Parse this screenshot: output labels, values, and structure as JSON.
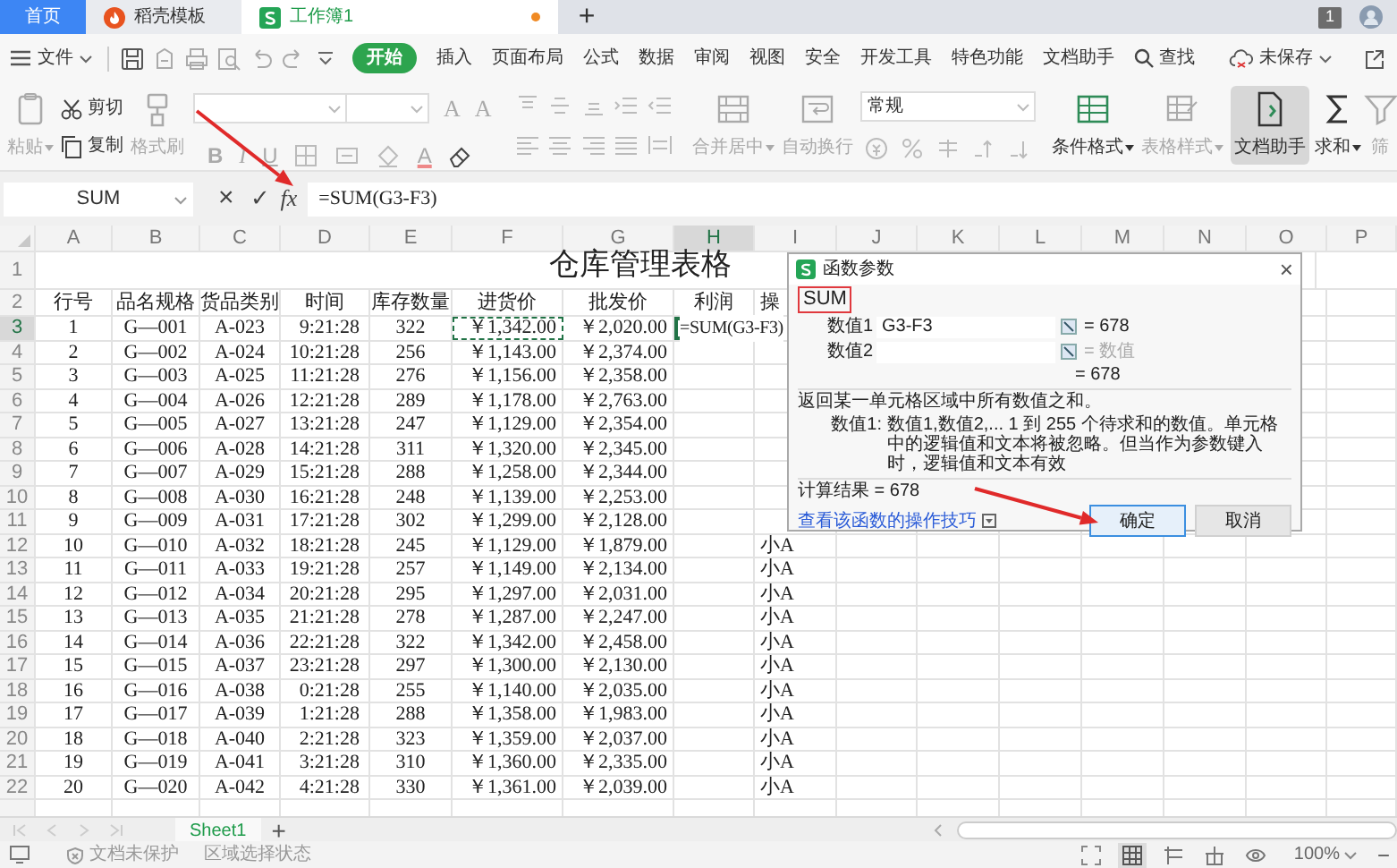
{
  "tabs": [
    {
      "kind": "home",
      "label": "首页",
      "selected": false
    },
    {
      "kind": "docer",
      "label": "稻壳模板",
      "selected": false
    },
    {
      "kind": "document",
      "label": "工作簿1",
      "selected": true,
      "unsaved": true
    }
  ],
  "new_tab": "+",
  "notification_count": "1",
  "menu": {
    "file": "文件",
    "items": [
      {
        "label": "开始",
        "selected": true
      },
      {
        "label": "插入",
        "selected": false
      },
      {
        "label": "页面布局",
        "selected": false
      },
      {
        "label": "公式",
        "selected": false
      },
      {
        "label": "数据",
        "selected": false
      },
      {
        "label": "审阅",
        "selected": false
      },
      {
        "label": "视图",
        "selected": false
      },
      {
        "label": "安全",
        "selected": false
      },
      {
        "label": "开发工具",
        "selected": false
      },
      {
        "label": "特色功能",
        "selected": false
      },
      {
        "label": "文档助手",
        "selected": false
      }
    ],
    "search": "查找",
    "save_status": "未保存"
  },
  "ribbon": [
    {
      "kind": "large",
      "label": "粘贴",
      "dropdown": true,
      "disabled": true,
      "pressed": false
    },
    {
      "kind": "stack",
      "items": [
        {
          "label": "剪切",
          "disabled": false
        },
        {
          "label": "复制",
          "disabled": false
        }
      ]
    },
    {
      "kind": "large",
      "label": "格式刷",
      "dropdown": false,
      "disabled": true,
      "pressed": false
    },
    {
      "kind": "font",
      "disabled": true,
      "size_buttons": [
        "A",
        "A"
      ],
      "style_buttons": [
        "B",
        "I",
        "U"
      ],
      "color_button": "A"
    },
    {
      "kind": "align",
      "disabled": true
    },
    {
      "kind": "large",
      "label": "合并居中",
      "dropdown": true,
      "disabled": true,
      "pressed": false
    },
    {
      "kind": "large",
      "label": "自动换行",
      "dropdown": false,
      "disabled": true,
      "pressed": false
    },
    {
      "kind": "number",
      "format": "常规",
      "disabled": true
    },
    {
      "kind": "large",
      "label": "条件格式",
      "dropdown": true,
      "disabled": false,
      "pressed": false
    },
    {
      "kind": "large",
      "label": "表格样式",
      "dropdown": true,
      "disabled": true,
      "pressed": false
    },
    {
      "kind": "large",
      "label": "文档助手",
      "dropdown": false,
      "disabled": false,
      "pressed": true
    },
    {
      "kind": "large",
      "label": "求和",
      "dropdown": true,
      "disabled": false,
      "pressed": false
    },
    {
      "kind": "large",
      "label": "筛",
      "dropdown": false,
      "disabled": true,
      "pressed": false
    }
  ],
  "formula_bar": {
    "name_box": "SUM",
    "cancel": "×",
    "confirm": "✓",
    "function": "fx",
    "formula": "=SUM(G3-F3)"
  },
  "sheet": {
    "columns": [
      {
        "label": "A",
        "selected": false
      },
      {
        "label": "B",
        "selected": false
      },
      {
        "label": "C",
        "selected": false
      },
      {
        "label": "D",
        "selected": false
      },
      {
        "label": "E",
        "selected": false
      },
      {
        "label": "F",
        "selected": false
      },
      {
        "label": "G",
        "selected": false
      },
      {
        "label": "H",
        "selected": true
      },
      {
        "label": "I",
        "selected": false
      },
      {
        "label": "J",
        "selected": false
      },
      {
        "label": "K",
        "selected": false
      },
      {
        "label": "L",
        "selected": false
      },
      {
        "label": "M",
        "selected": false
      },
      {
        "label": "N",
        "selected": false
      },
      {
        "label": "O",
        "selected": false
      },
      {
        "label": "P",
        "selected": false
      }
    ],
    "title_row": {
      "row": "1",
      "title": "仓库管理表格"
    },
    "header_row": {
      "row": "2",
      "cells": [
        "行号",
        "品名规格",
        "货品类别",
        "时间",
        "库存数量",
        "进货价",
        "批发价",
        "利润",
        "操"
      ]
    },
    "rows": [
      {
        "row": "3",
        "selected": true,
        "cells": [
          "1",
          "G—001",
          "A-023",
          "9:21:28",
          "322",
          {
            "text": "￥1,342.00",
            "referenced": true
          },
          "￥2,020.00"
        ],
        "profit": "=SUM(G3-F3)"
      },
      {
        "row": "4",
        "selected": false,
        "cells": [
          "2",
          "G—002",
          "A-024",
          "10:21:28",
          "256",
          "￥1,143.00",
          "￥2,374.00"
        ]
      },
      {
        "row": "5",
        "selected": false,
        "cells": [
          "3",
          "G—003",
          "A-025",
          "11:21:28",
          "276",
          "￥1,156.00",
          "￥2,358.00"
        ]
      },
      {
        "row": "6",
        "selected": false,
        "cells": [
          "4",
          "G—004",
          "A-026",
          "12:21:28",
          "289",
          "￥1,178.00",
          "￥2,763.00"
        ]
      },
      {
        "row": "7",
        "selected": false,
        "cells": [
          "5",
          "G—005",
          "A-027",
          "13:21:28",
          "247",
          "￥1,129.00",
          "￥2,354.00"
        ]
      },
      {
        "row": "8",
        "selected": false,
        "cells": [
          "6",
          "G—006",
          "A-028",
          "14:21:28",
          "311",
          "￥1,320.00",
          "￥2,345.00"
        ]
      },
      {
        "row": "9",
        "selected": false,
        "cells": [
          "7",
          "G—007",
          "A-029",
          "15:21:28",
          "288",
          "￥1,258.00",
          "￥2,344.00"
        ]
      },
      {
        "row": "10",
        "selected": false,
        "cells": [
          "8",
          "G—008",
          "A-030",
          "16:21:28",
          "248",
          "￥1,139.00",
          "￥2,253.00"
        ]
      },
      {
        "row": "11",
        "selected": false,
        "cells": [
          "9",
          "G—009",
          "A-031",
          "17:21:28",
          "302",
          "￥1,299.00",
          "￥2,128.00"
        ]
      },
      {
        "row": "12",
        "selected": false,
        "cells": [
          "10",
          "G—010",
          "A-032",
          "18:21:28",
          "245",
          "￥1,129.00",
          "￥1,879.00"
        ],
        "column_9": "小A"
      },
      {
        "row": "13",
        "selected": false,
        "cells": [
          "11",
          "G—011",
          "A-033",
          "19:21:28",
          "257",
          "￥1,149.00",
          "￥2,134.00"
        ],
        "column_9": "小A"
      },
      {
        "row": "14",
        "selected": false,
        "cells": [
          "12",
          "G—012",
          "A-034",
          "20:21:28",
          "295",
          "￥1,297.00",
          "￥2,031.00"
        ],
        "column_9": "小A"
      },
      {
        "row": "15",
        "selected": false,
        "cells": [
          "13",
          "G—013",
          "A-035",
          "21:21:28",
          "278",
          "￥1,287.00",
          "￥2,247.00"
        ],
        "column_9": "小A"
      },
      {
        "row": "16",
        "selected": false,
        "cells": [
          "14",
          "G—014",
          "A-036",
          "22:21:28",
          "322",
          "￥1,342.00",
          "￥2,458.00"
        ],
        "column_9": "小A"
      },
      {
        "row": "17",
        "selected": false,
        "cells": [
          "15",
          "G—015",
          "A-037",
          "23:21:28",
          "297",
          "￥1,300.00",
          "￥2,130.00"
        ],
        "column_9": "小A"
      },
      {
        "row": "18",
        "selected": false,
        "cells": [
          "16",
          "G—016",
          "A-038",
          "0:21:28",
          "255",
          "￥1,140.00",
          "￥2,035.00"
        ],
        "column_9": "小A"
      },
      {
        "row": "19",
        "selected": false,
        "cells": [
          "17",
          "G—017",
          "A-039",
          "1:21:28",
          "288",
          "￥1,358.00",
          "￥1,983.00"
        ],
        "column_9": "小A"
      },
      {
        "row": "20",
        "selected": false,
        "cells": [
          "18",
          "G—018",
          "A-040",
          "2:21:28",
          "323",
          "￥1,359.00",
          "￥2,037.00"
        ],
        "column_9": "小A"
      },
      {
        "row": "21",
        "selected": false,
        "cells": [
          "19",
          "G—019",
          "A-041",
          "3:21:28",
          "310",
          "￥1,360.00",
          "￥2,335.00"
        ],
        "column_9": "小A"
      },
      {
        "row": "22",
        "selected": false,
        "cells": [
          "20",
          "G—020",
          "A-042",
          "4:21:28",
          "330",
          "￥1,361.00",
          "￥2,039.00"
        ],
        "column_9": "小A"
      }
    ]
  },
  "sheets": [
    {
      "label": "Sheet1",
      "selected": true
    }
  ],
  "add_sheet": "+",
  "status_bar": {
    "items": [
      "文档未保护",
      "区域选择状态"
    ],
    "views": [
      {
        "selected": false
      },
      {
        "selected": true
      },
      {
        "selected": false
      },
      {
        "selected": false
      },
      {
        "selected": false
      }
    ],
    "zoom": "100%",
    "zoom_out": "−"
  },
  "dialog": {
    "title": "函数参数",
    "close": "×",
    "function_name": "SUM",
    "arguments": [
      {
        "label": "数值1",
        "value": "G3-F3",
        "result": "= 678",
        "muted": false
      },
      {
        "label": "数值2",
        "result": "= 数值",
        "muted": true
      }
    ],
    "result": "= 678",
    "description": "返回某一单元格区域中所有数值之和。",
    "argument_help": {
      "label": "数值1:",
      "text": "数值1,数值2,... 1 到 255 个待求和的数值。单元格中的逻辑值和文本将被忽略。但当作为参数键入时，逻辑值和文本有效"
    },
    "calculation": "计算结果 = 678",
    "help_link": "查看该函数的操作技巧",
    "buttons": [
      {
        "label": "确定",
        "focused": true
      },
      {
        "label": "取消",
        "focused": false
      }
    ]
  }
}
